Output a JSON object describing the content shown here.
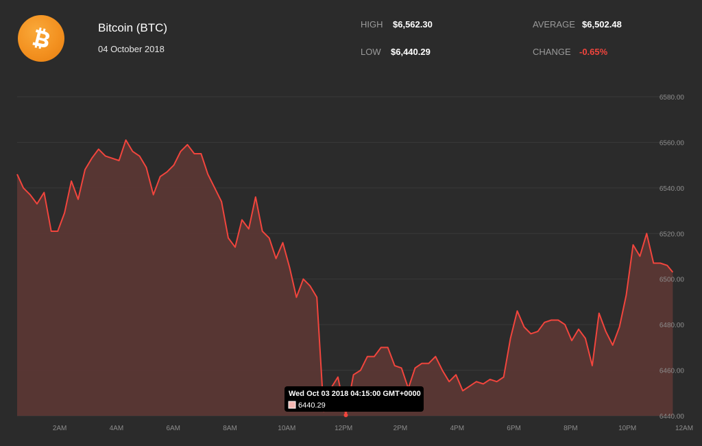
{
  "header": {
    "coin_name": "Bitcoin (BTC)",
    "date": "04 October 2018",
    "high_label": "HIGH",
    "high_value": "$6,562.30",
    "low_label": "LOW",
    "low_value": "$6,440.29",
    "average_label": "AVERAGE",
    "average_value": "$6,502.48",
    "change_label": "CHANGE",
    "change_value": "-0.65%"
  },
  "icons": {
    "logo": "bitcoin-icon"
  },
  "colors": {
    "background": "#2b2b2b",
    "line": "#f2453d",
    "fill": "#5a3734",
    "negative": "#f2453d",
    "logo": "#f39120"
  },
  "tooltip": {
    "title": "Wed Oct 03 2018 04:15:00 GMT+0000",
    "value": "6440.29"
  },
  "chart_data": {
    "type": "area",
    "title": "",
    "xlabel": "",
    "ylabel": "",
    "ylim": [
      6440,
      6580
    ],
    "xlim": [
      0.5,
      24
    ],
    "grid": true,
    "y_ticks": [
      "6580.00",
      "6560.00",
      "6540.00",
      "6520.00",
      "6500.00",
      "6480.00",
      "6460.00",
      "6440.00"
    ],
    "x_ticks": [
      "2AM",
      "4AM",
      "6AM",
      "8AM",
      "10AM",
      "12PM",
      "2PM",
      "4PM",
      "6PM",
      "8PM",
      "10PM",
      "12AM"
    ],
    "x_tick_hours": [
      2,
      4,
      6,
      8,
      10,
      12,
      14,
      16,
      18,
      20,
      22,
      24
    ],
    "series": [
      {
        "values": [
          {
            "x": 0.5,
            "y": 6546
          },
          {
            "x": 0.72,
            "y": 6540
          },
          {
            "x": 0.96,
            "y": 6537
          },
          {
            "x": 1.2,
            "y": 6533
          },
          {
            "x": 1.45,
            "y": 6538
          },
          {
            "x": 1.7,
            "y": 6521
          },
          {
            "x": 1.93,
            "y": 6521
          },
          {
            "x": 2.17,
            "y": 6529
          },
          {
            "x": 2.41,
            "y": 6543
          },
          {
            "x": 2.65,
            "y": 6535
          },
          {
            "x": 2.89,
            "y": 6548
          },
          {
            "x": 3.13,
            "y": 6553
          },
          {
            "x": 3.37,
            "y": 6557
          },
          {
            "x": 3.61,
            "y": 6554
          },
          {
            "x": 3.85,
            "y": 6553
          },
          {
            "x": 4.09,
            "y": 6552
          },
          {
            "x": 4.33,
            "y": 6561
          },
          {
            "x": 4.57,
            "y": 6556
          },
          {
            "x": 4.81,
            "y": 6554
          },
          {
            "x": 5.05,
            "y": 6549
          },
          {
            "x": 5.3,
            "y": 6537
          },
          {
            "x": 5.54,
            "y": 6545
          },
          {
            "x": 5.78,
            "y": 6547
          },
          {
            "x": 6.02,
            "y": 6550
          },
          {
            "x": 6.26,
            "y": 6556
          },
          {
            "x": 6.5,
            "y": 6559
          },
          {
            "x": 6.74,
            "y": 6555
          },
          {
            "x": 6.98,
            "y": 6555
          },
          {
            "x": 7.22,
            "y": 6546
          },
          {
            "x": 7.46,
            "y": 6540
          },
          {
            "x": 7.7,
            "y": 6534
          },
          {
            "x": 7.94,
            "y": 6518
          },
          {
            "x": 8.18,
            "y": 6514
          },
          {
            "x": 8.42,
            "y": 6526
          },
          {
            "x": 8.66,
            "y": 6522
          },
          {
            "x": 8.9,
            "y": 6536
          },
          {
            "x": 9.14,
            "y": 6521
          },
          {
            "x": 9.38,
            "y": 6518
          },
          {
            "x": 9.62,
            "y": 6509
          },
          {
            "x": 9.86,
            "y": 6516
          },
          {
            "x": 10.1,
            "y": 6505
          },
          {
            "x": 10.34,
            "y": 6492
          },
          {
            "x": 10.58,
            "y": 6500
          },
          {
            "x": 10.82,
            "y": 6497
          },
          {
            "x": 11.06,
            "y": 6492
          },
          {
            "x": 11.3,
            "y": 6442
          },
          {
            "x": 11.55,
            "y": 6452
          },
          {
            "x": 11.8,
            "y": 6457
          },
          {
            "x": 12.08,
            "y": 6440.29
          },
          {
            "x": 12.35,
            "y": 6458
          },
          {
            "x": 12.6,
            "y": 6460
          },
          {
            "x": 12.84,
            "y": 6466
          },
          {
            "x": 13.08,
            "y": 6466
          },
          {
            "x": 13.32,
            "y": 6470
          },
          {
            "x": 13.56,
            "y": 6470
          },
          {
            "x": 13.8,
            "y": 6462
          },
          {
            "x": 14.04,
            "y": 6461
          },
          {
            "x": 14.28,
            "y": 6452
          },
          {
            "x": 14.52,
            "y": 6461
          },
          {
            "x": 14.76,
            "y": 6463
          },
          {
            "x": 15.0,
            "y": 6463
          },
          {
            "x": 15.24,
            "y": 6466
          },
          {
            "x": 15.48,
            "y": 6460
          },
          {
            "x": 15.72,
            "y": 6455
          },
          {
            "x": 15.96,
            "y": 6458
          },
          {
            "x": 16.2,
            "y": 6451
          },
          {
            "x": 16.44,
            "y": 6453
          },
          {
            "x": 16.68,
            "y": 6455
          },
          {
            "x": 16.92,
            "y": 6454
          },
          {
            "x": 17.16,
            "y": 6456
          },
          {
            "x": 17.4,
            "y": 6455
          },
          {
            "x": 17.64,
            "y": 6457
          },
          {
            "x": 17.88,
            "y": 6474
          },
          {
            "x": 18.12,
            "y": 6486
          },
          {
            "x": 18.36,
            "y": 6479
          },
          {
            "x": 18.6,
            "y": 6476
          },
          {
            "x": 18.84,
            "y": 6477
          },
          {
            "x": 19.08,
            "y": 6481
          },
          {
            "x": 19.32,
            "y": 6482
          },
          {
            "x": 19.56,
            "y": 6482
          },
          {
            "x": 19.8,
            "y": 6480
          },
          {
            "x": 20.04,
            "y": 6473
          },
          {
            "x": 20.28,
            "y": 6478
          },
          {
            "x": 20.52,
            "y": 6474
          },
          {
            "x": 20.76,
            "y": 6462
          },
          {
            "x": 21.0,
            "y": 6485
          },
          {
            "x": 21.24,
            "y": 6477
          },
          {
            "x": 21.48,
            "y": 6471
          },
          {
            "x": 21.72,
            "y": 6479
          },
          {
            "x": 21.96,
            "y": 6493
          },
          {
            "x": 22.2,
            "y": 6515
          },
          {
            "x": 22.44,
            "y": 6510
          },
          {
            "x": 22.68,
            "y": 6520
          },
          {
            "x": 22.92,
            "y": 6507
          },
          {
            "x": 23.16,
            "y": 6507
          },
          {
            "x": 23.4,
            "y": 6506
          },
          {
            "x": 23.6,
            "y": 6503
          }
        ]
      }
    ],
    "highlight": {
      "x": 12.08,
      "y": 6440.29
    }
  }
}
